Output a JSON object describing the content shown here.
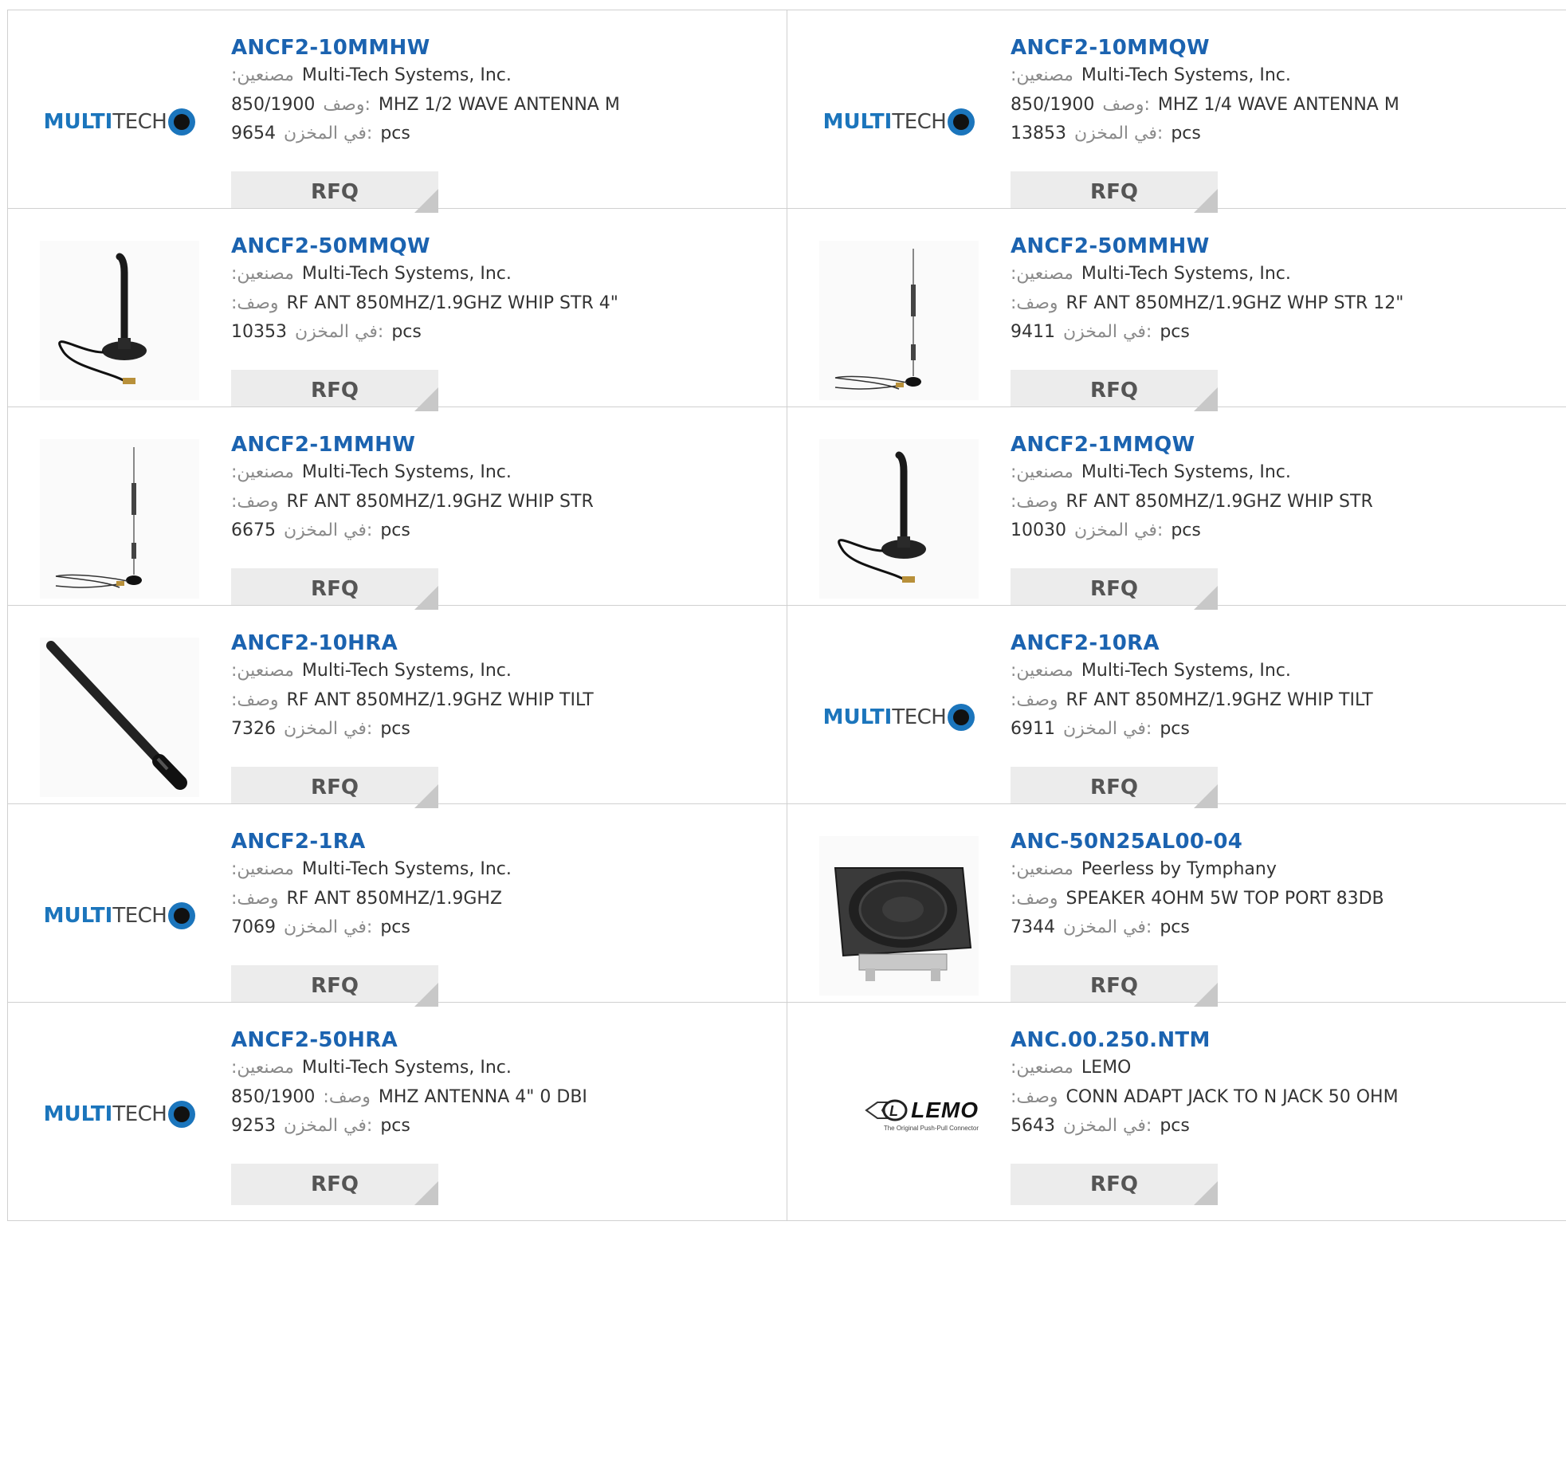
{
  "labels": {
    "manufacturer": ":مصنعين",
    "description": "وصف",
    "stock": "في المخزن:",
    "unit": "pcs",
    "rfq": "RFQ"
  },
  "logos": {
    "multitech_part1": "MULTI",
    "multitech_part2": "TECH",
    "lemo_brand": "LEMO",
    "lemo_tagline": "The Original Push-Pull Connector"
  },
  "colors": {
    "title_link": "#1b63b0",
    "logo_blue": "#1b75bc",
    "button_bg": "#ececec"
  },
  "products": [
    {
      "part": "ANCF2-10MMHW",
      "manufacturer": "Multi-Tech Systems, Inc.",
      "desc_lead": "850/1900",
      "desc_label": "وصف:",
      "desc_rest": "MHZ 1/2 WAVE ANTENNA M",
      "stock": "9654",
      "image": "multitech-logo"
    },
    {
      "part": "ANCF2-10MMQW",
      "manufacturer": "Multi-Tech Systems, Inc.",
      "desc_lead": "850/1900",
      "desc_label": "وصف:",
      "desc_rest": "MHZ 1/4 WAVE ANTENNA M",
      "stock": "13853",
      "image": "multitech-logo"
    },
    {
      "part": "ANCF2-50MMQW",
      "manufacturer": "Multi-Tech Systems, Inc.",
      "desc_lead": "",
      "desc_label": ":وصف",
      "desc_rest": "RF ANT 850MHZ/1.9GHZ WHIP STR 4\"",
      "stock": "10353",
      "image": "magnet-short-antenna"
    },
    {
      "part": "ANCF2-50MMHW",
      "manufacturer": "Multi-Tech Systems, Inc.",
      "desc_lead": "",
      "desc_label": ":وصف",
      "desc_rest": "RF ANT 850MHZ/1.9GHZ WHP STR 12\"",
      "stock": "9411",
      "image": "whip-tall-antenna"
    },
    {
      "part": "ANCF2-1MMHW",
      "manufacturer": "Multi-Tech Systems, Inc.",
      "desc_lead": "",
      "desc_label": ":وصف",
      "desc_rest": "RF ANT 850MHZ/1.9GHZ WHIP STR",
      "stock": "6675",
      "image": "whip-tall-antenna"
    },
    {
      "part": "ANCF2-1MMQW",
      "manufacturer": "Multi-Tech Systems, Inc.",
      "desc_lead": "",
      "desc_label": ":وصف",
      "desc_rest": "RF ANT 850MHZ/1.9GHZ WHIP STR",
      "stock": "10030",
      "image": "magnet-short-antenna"
    },
    {
      "part": "ANCF2-10HRA",
      "manufacturer": "Multi-Tech Systems, Inc.",
      "desc_lead": "",
      "desc_label": ":وصف",
      "desc_rest": "RF ANT 850MHZ/1.9GHZ WHIP TILT",
      "stock": "7326",
      "image": "rubber-duck-antenna"
    },
    {
      "part": "ANCF2-10RA",
      "manufacturer": "Multi-Tech Systems, Inc.",
      "desc_lead": "",
      "desc_label": ":وصف",
      "desc_rest": "RF ANT 850MHZ/1.9GHZ WHIP TILT",
      "stock": "6911",
      "image": "multitech-logo"
    },
    {
      "part": "ANCF2-1RA",
      "manufacturer": "Multi-Tech Systems, Inc.",
      "desc_lead": "",
      "desc_label": ":وصف",
      "desc_rest": "RF ANT 850MHZ/1.9GHZ",
      "stock": "7069",
      "image": "multitech-logo"
    },
    {
      "part": "ANC-50N25AL00-04",
      "manufacturer": "Peerless by Tymphany",
      "desc_lead": "",
      "desc_label": ":وصف",
      "desc_rest": "SPEAKER 4OHM 5W TOP PORT 83DB",
      "stock": "7344",
      "image": "speaker"
    },
    {
      "part": "ANCF2-50HRA",
      "manufacturer": "Multi-Tech Systems, Inc.",
      "desc_lead": "850/1900",
      "desc_label": ":وصف",
      "desc_rest": "MHZ ANTENNA 4\" 0 DBI",
      "stock": "9253",
      "image": "multitech-logo"
    },
    {
      "part": "ANC.00.250.NTM",
      "manufacturer": "LEMO",
      "desc_lead": "",
      "desc_label": ":وصف",
      "desc_rest": "CONN ADAPT JACK TO N JACK 50 OHM",
      "stock": "5643",
      "image": "lemo-logo"
    }
  ]
}
